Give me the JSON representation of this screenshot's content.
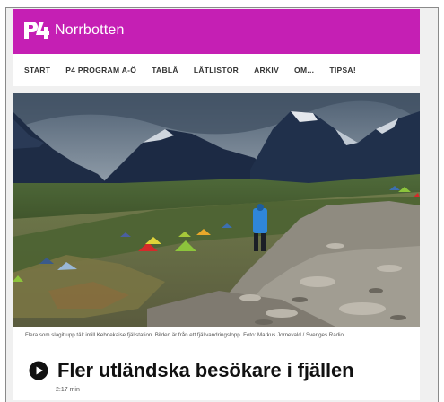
{
  "brand": {
    "logo_text": "Norrbotten",
    "color": "#c51fb4"
  },
  "nav": {
    "items": [
      "START",
      "P4 PROGRAM A-Ö",
      "TABLÅ",
      "LÅTLISTOR",
      "ARKIV",
      "OM...",
      "TIPSA!"
    ]
  },
  "hero": {
    "caption": "Flera som slagit upp tält intill Kebnekaise fjällstation. Bilden är från ett fjällvandringslopp. Foto: Markus Jornevald / Sveriges Radio"
  },
  "article": {
    "title": "Fler utländska besökare i fjällen",
    "duration": "2:17 min"
  }
}
